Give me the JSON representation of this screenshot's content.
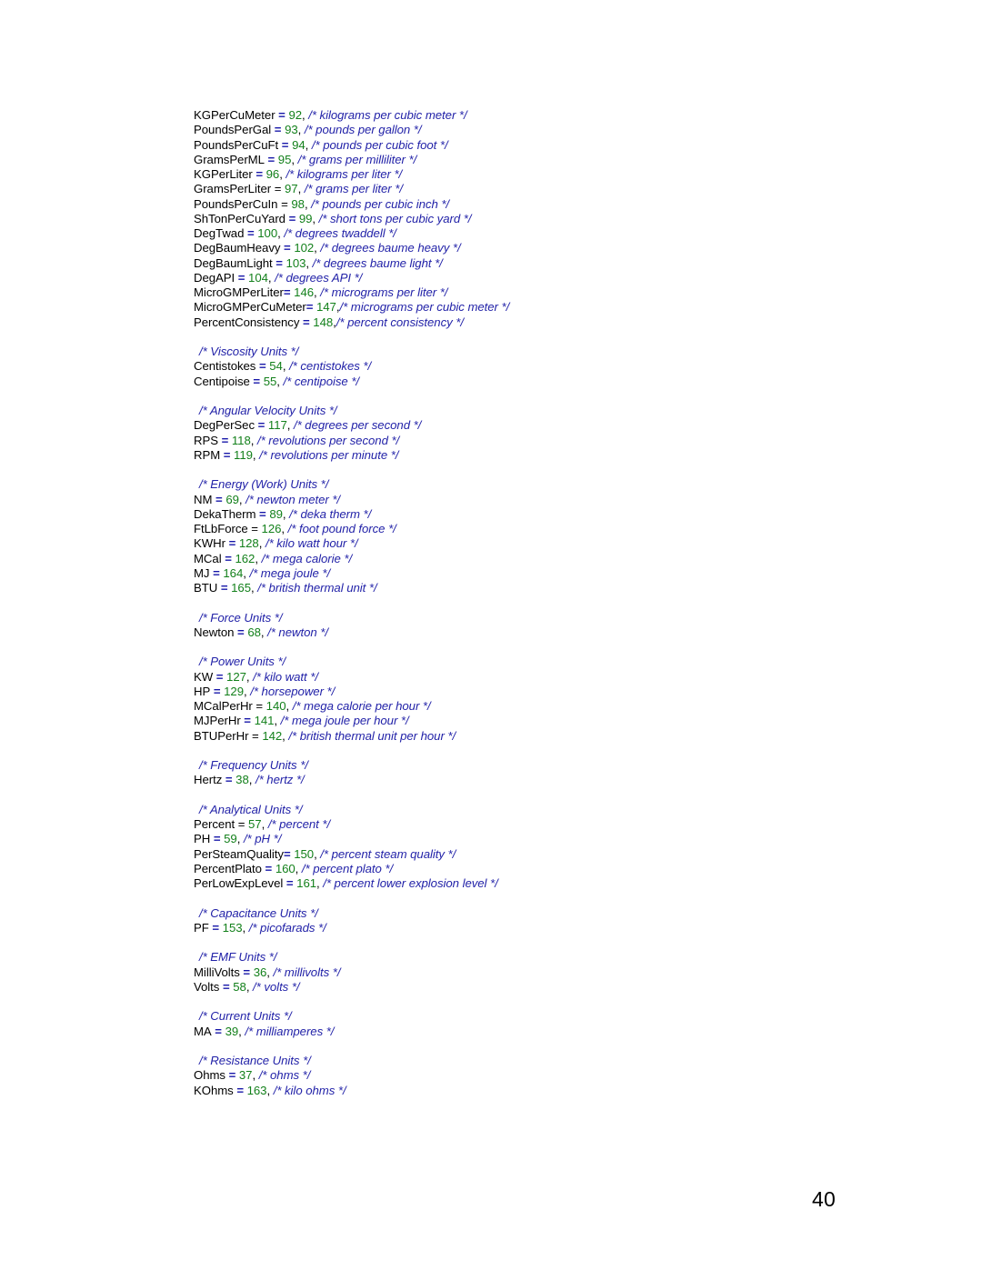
{
  "document": {
    "page_number": "40",
    "colors": {
      "identifier": "#000000",
      "operator": "#1515a8",
      "number": "#13801b",
      "comment": "#2222a8",
      "background": "#ffffff"
    }
  },
  "listing": {
    "lines": [
      {
        "kind": "decl",
        "id": "KGPerCuMeter",
        "eq": " = ",
        "eq_bold": true,
        "num": "92",
        "sep": ", ",
        "comment": "/* kilograms per cubic meter */"
      },
      {
        "kind": "decl",
        "id": "PoundsPerGal",
        "eq": " = ",
        "eq_bold": true,
        "num": "93",
        "sep": ", ",
        "comment": "/* pounds per gallon */"
      },
      {
        "kind": "decl",
        "id": "PoundsPerCuFt",
        "eq": " = ",
        "eq_bold": true,
        "num": "94",
        "sep": ", ",
        "comment": "/* pounds per cubic foot */"
      },
      {
        "kind": "decl",
        "id": "GramsPerML",
        "eq": " = ",
        "eq_bold": true,
        "num": "95",
        "sep": ", ",
        "comment": "/* grams per milliliter */"
      },
      {
        "kind": "decl",
        "id": "KGPerLiter",
        "eq": " = ",
        "eq_bold": true,
        "num": "96",
        "sep": ", ",
        "comment": "/* kilograms per liter */"
      },
      {
        "kind": "decl",
        "id": "GramsPerLiter",
        "eq": " = ",
        "eq_bold": false,
        "num": "97",
        "sep": ", ",
        "comment": "/* grams per liter */"
      },
      {
        "kind": "decl",
        "id": "PoundsPerCuIn",
        "eq": " = ",
        "eq_bold": false,
        "num": "98",
        "sep": ", ",
        "comment": "/* pounds per cubic inch */"
      },
      {
        "kind": "decl",
        "id": "ShTonPerCuYard",
        "eq": " = ",
        "eq_bold": true,
        "num": "99",
        "sep": ", ",
        "comment": "/* short tons per cubic yard */"
      },
      {
        "kind": "decl",
        "id": "DegTwad",
        "eq": " = ",
        "eq_bold": true,
        "num": "100",
        "sep": ", ",
        "comment": "/* degrees twaddell */"
      },
      {
        "kind": "decl",
        "id": "DegBaumHeavy",
        "eq": " = ",
        "eq_bold": true,
        "num": "102",
        "sep": ", ",
        "comment": "/* degrees baume heavy */"
      },
      {
        "kind": "decl",
        "id": "DegBaumLight",
        "eq": " = ",
        "eq_bold": true,
        "num": "103",
        "sep": ", ",
        "comment": "/* degrees baume light */"
      },
      {
        "kind": "decl",
        "id": "DegAPI",
        "eq": " = ",
        "eq_bold": true,
        "num": "104",
        "sep": ", ",
        "comment": "/* degrees API */"
      },
      {
        "kind": "decl",
        "id": "MicroGMPerLiter",
        "eq": "= ",
        "eq_bold": true,
        "num": "146",
        "sep": ", ",
        "comment": "/* micrograms per liter */"
      },
      {
        "kind": "decl",
        "id": "MicroGMPerCuMeter",
        "eq": "= ",
        "eq_bold": true,
        "num": "147",
        "sep": ",",
        "comment": "/* micrograms per cubic meter */"
      },
      {
        "kind": "decl",
        "id": "PercentConsistency",
        "eq": " = ",
        "eq_bold": true,
        "num": "148",
        "sep": ",",
        "comment": "/* percent consistency */"
      },
      {
        "kind": "blank"
      },
      {
        "kind": "section",
        "comment": "/* Viscosity Units */"
      },
      {
        "kind": "decl",
        "id": "Centistokes",
        "eq": " = ",
        "eq_bold": true,
        "num": "54",
        "sep": ", ",
        "comment": "/* centistokes */"
      },
      {
        "kind": "decl",
        "id": "Centipoise",
        "eq": " = ",
        "eq_bold": true,
        "num": "55",
        "sep": ", ",
        "comment": "/* centipoise */"
      },
      {
        "kind": "blank"
      },
      {
        "kind": "section",
        "comment": "/* Angular Velocity Units */"
      },
      {
        "kind": "decl",
        "id": "DegPerSec",
        "eq": " = ",
        "eq_bold": true,
        "num": "117",
        "sep": ", ",
        "comment": "/* degrees per second */"
      },
      {
        "kind": "decl",
        "id": "RPS",
        "eq": " = ",
        "eq_bold": true,
        "num": "118",
        "sep": ", ",
        "comment": "/* revolutions per second */"
      },
      {
        "kind": "decl",
        "id": "RPM",
        "eq": " = ",
        "eq_bold": true,
        "num": "119",
        "sep": ", ",
        "comment": "/* revolutions per minute */"
      },
      {
        "kind": "blank"
      },
      {
        "kind": "section",
        "comment": "/* Energy (Work) Units */"
      },
      {
        "kind": "decl",
        "id": "NM",
        "eq": " = ",
        "eq_bold": true,
        "num": "69",
        "sep": ", ",
        "comment": "/* newton meter */"
      },
      {
        "kind": "decl",
        "id": "DekaTherm",
        "eq": " = ",
        "eq_bold": true,
        "num": "89",
        "sep": ", ",
        "comment": "/* deka therm */"
      },
      {
        "kind": "decl",
        "id": "FtLbForce",
        "eq": " = ",
        "eq_bold": false,
        "num": "126",
        "sep": ", ",
        "comment": "/* foot pound force */"
      },
      {
        "kind": "decl",
        "id": "KWHr",
        "eq": " = ",
        "eq_bold": true,
        "num": "128",
        "sep": ", ",
        "comment": "/* kilo watt hour */"
      },
      {
        "kind": "decl",
        "id": "MCal",
        "eq": " = ",
        "eq_bold": true,
        "num": "162",
        "sep": ", ",
        "comment": "/* mega calorie */"
      },
      {
        "kind": "decl",
        "id": "MJ",
        "eq": " = ",
        "eq_bold": true,
        "num": "164",
        "sep": ", ",
        "comment": "/* mega joule */"
      },
      {
        "kind": "decl",
        "id": "BTU",
        "eq": " = ",
        "eq_bold": true,
        "num": "165",
        "sep": ", ",
        "comment": "/* british thermal unit */"
      },
      {
        "kind": "blank"
      },
      {
        "kind": "section",
        "comment": "/* Force Units */"
      },
      {
        "kind": "decl",
        "id": "Newton",
        "eq": " = ",
        "eq_bold": true,
        "num": "68",
        "sep": ", ",
        "comment": "/* newton */"
      },
      {
        "kind": "blank"
      },
      {
        "kind": "section",
        "comment": "/* Power Units */"
      },
      {
        "kind": "decl",
        "id": "KW",
        "eq": " = ",
        "eq_bold": true,
        "num": "127",
        "sep": ", ",
        "comment": "/* kilo watt */"
      },
      {
        "kind": "decl",
        "id": "HP",
        "eq": " = ",
        "eq_bold": true,
        "num": "129",
        "sep": ", ",
        "comment": "/* horsepower */"
      },
      {
        "kind": "decl",
        "id": "MCalPerHr",
        "eq": " = ",
        "eq_bold": false,
        "num": "140",
        "sep": ", ",
        "comment": "/* mega calorie per hour */"
      },
      {
        "kind": "decl",
        "id": "MJPerHr",
        "eq": " = ",
        "eq_bold": true,
        "num": "141",
        "sep": ", ",
        "comment": "/* mega joule per hour */"
      },
      {
        "kind": "decl",
        "id": "BTUPerHr",
        "eq": " = ",
        "eq_bold": false,
        "num": "142",
        "sep": ", ",
        "comment": "/* british thermal unit per hour */"
      },
      {
        "kind": "blank"
      },
      {
        "kind": "section",
        "comment": "/* Frequency Units */"
      },
      {
        "kind": "decl",
        "id": "Hertz",
        "eq": " = ",
        "eq_bold": true,
        "num": "38",
        "sep": ", ",
        "comment": "/* hertz */"
      },
      {
        "kind": "blank"
      },
      {
        "kind": "section",
        "comment": "/* Analytical Units */"
      },
      {
        "kind": "decl",
        "id": "Percent",
        "eq": " = ",
        "eq_bold": false,
        "num": "57",
        "sep": ", ",
        "comment": "/* percent */"
      },
      {
        "kind": "decl",
        "id": "PH",
        "eq": " = ",
        "eq_bold": true,
        "num": "59",
        "sep": ", ",
        "comment": "/* pH */"
      },
      {
        "kind": "decl",
        "id": "PerSteamQuality",
        "eq": "= ",
        "eq_bold": true,
        "num": "150",
        "sep": ", ",
        "comment": "/* percent steam quality */"
      },
      {
        "kind": "decl",
        "id": "PercentPlato",
        "eq": " = ",
        "eq_bold": true,
        "num": "160",
        "sep": ", ",
        "comment": "/* percent plato */"
      },
      {
        "kind": "decl",
        "id": "PerLowExpLevel",
        "eq": " = ",
        "eq_bold": true,
        "num": "161",
        "sep": ", ",
        "comment": "/* percent lower explosion level */"
      },
      {
        "kind": "blank"
      },
      {
        "kind": "section",
        "comment": "/* Capacitance Units */"
      },
      {
        "kind": "decl",
        "id": "PF",
        "eq": " = ",
        "eq_bold": true,
        "num": "153",
        "sep": ", ",
        "comment": "/* picofarads */"
      },
      {
        "kind": "blank"
      },
      {
        "kind": "section",
        "comment": "/* EMF Units */"
      },
      {
        "kind": "decl",
        "id": "MilliVolts",
        "eq": " = ",
        "eq_bold": true,
        "num": "36",
        "sep": ", ",
        "comment": "/* millivolts */"
      },
      {
        "kind": "decl",
        "id": "Volts",
        "eq": " = ",
        "eq_bold": true,
        "num": "58",
        "sep": ", ",
        "comment": "/* volts */"
      },
      {
        "kind": "blank"
      },
      {
        "kind": "section",
        "comment": "/* Current Units */"
      },
      {
        "kind": "decl",
        "id": "MA",
        "eq": " = ",
        "eq_bold": true,
        "num": "39",
        "sep": ", ",
        "comment": "/* milliamperes */"
      },
      {
        "kind": "blank"
      },
      {
        "kind": "section",
        "comment": "/* Resistance Units */"
      },
      {
        "kind": "decl",
        "id": "Ohms",
        "eq": " = ",
        "eq_bold": true,
        "num": "37",
        "sep": ", ",
        "comment": "/* ohms */"
      },
      {
        "kind": "decl",
        "id": "KOhms",
        "eq": " = ",
        "eq_bold": true,
        "num": "163",
        "sep": ", ",
        "comment": "/* kilo ohms */"
      }
    ]
  }
}
